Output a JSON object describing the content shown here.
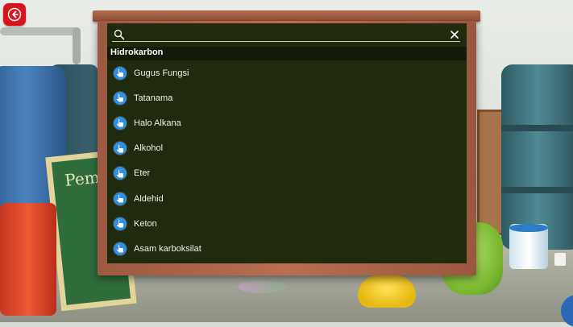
{
  "nav": {
    "back_icon": "back-arrow-icon",
    "back_color": "#d7141e"
  },
  "search": {
    "value": "",
    "placeholder": "",
    "search_icon": "search-icon",
    "clear_icon": "close-icon"
  },
  "section": {
    "title": "Hidrokarbon"
  },
  "list": {
    "item_icon": "pointer-hand-icon",
    "item_icon_color": "#2f8fe6",
    "items": [
      {
        "label": "Gugus Fungsi"
      },
      {
        "label": "Tatanama"
      },
      {
        "label": "Halo Alkana"
      },
      {
        "label": "Alkohol"
      },
      {
        "label": "Eter"
      },
      {
        "label": "Aldehid"
      },
      {
        "label": "Keton"
      },
      {
        "label": "Asam karboksilat"
      }
    ]
  },
  "colors": {
    "board": "#1f2a0f",
    "frame": "#b16b4e",
    "header_bg": "#131a08",
    "text": "#f1f2ea"
  }
}
